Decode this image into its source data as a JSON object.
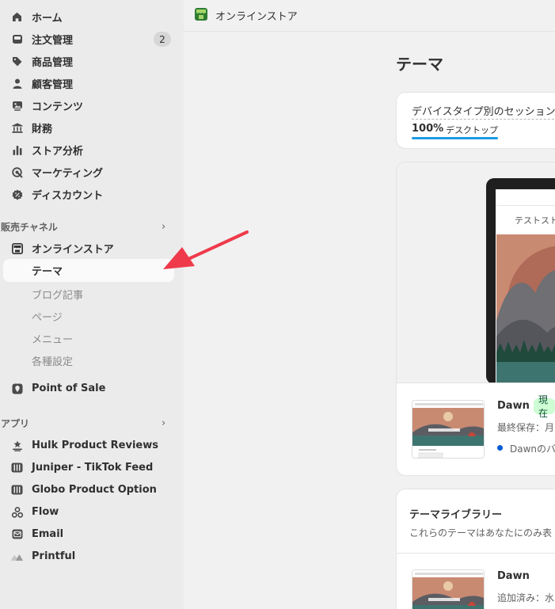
{
  "sidebar": {
    "main_items": [
      {
        "label": "ホーム",
        "icon": "home-icon"
      },
      {
        "label": "注文管理",
        "icon": "inbox-icon",
        "badge": "2"
      },
      {
        "label": "商品管理",
        "icon": "tag-icon"
      },
      {
        "label": "顧客管理",
        "icon": "person-icon"
      },
      {
        "label": "コンテンツ",
        "icon": "image-icon"
      },
      {
        "label": "財務",
        "icon": "bank-icon"
      },
      {
        "label": "ストア分析",
        "icon": "bar-chart-icon"
      },
      {
        "label": "マーケティング",
        "icon": "target-icon"
      },
      {
        "label": "ディスカウント",
        "icon": "discount-icon"
      }
    ],
    "sales_channels": {
      "heading": "販売チャネル",
      "online_store": "オンラインストア",
      "sub_items": [
        "テーマ",
        "ブログ記事",
        "ページ",
        "メニュー",
        "各種設定"
      ],
      "pos": "Point of Sale"
    },
    "apps": {
      "heading": "アプリ",
      "items": [
        "Hulk Product Reviews",
        "Juniper - TikTok Feed",
        "Globo Product Option",
        "Flow",
        "Email",
        "Printful"
      ]
    }
  },
  "topbar": {
    "title": "オンラインストア"
  },
  "page": {
    "title": "テーマ",
    "sessions_card": {
      "title": "デバイスタイプ別のセッション数",
      "percent": "100%",
      "device": "デスクトップ"
    },
    "preview": {
      "store_name": "テストストア"
    },
    "current_theme": {
      "name": "Dawn",
      "badge": "現在",
      "saved": "最終保存：月",
      "version": "Dawnのバ"
    },
    "library": {
      "title": "テーマライブラリー",
      "subtitle": "これらのテーマはあなたにのみ表",
      "theme_name": "Dawn",
      "added": "追加済み：水"
    }
  },
  "colors": {
    "accent": "#1e9be2",
    "badge_green": "#cdfed4",
    "arrow": "#ef3a4b"
  }
}
